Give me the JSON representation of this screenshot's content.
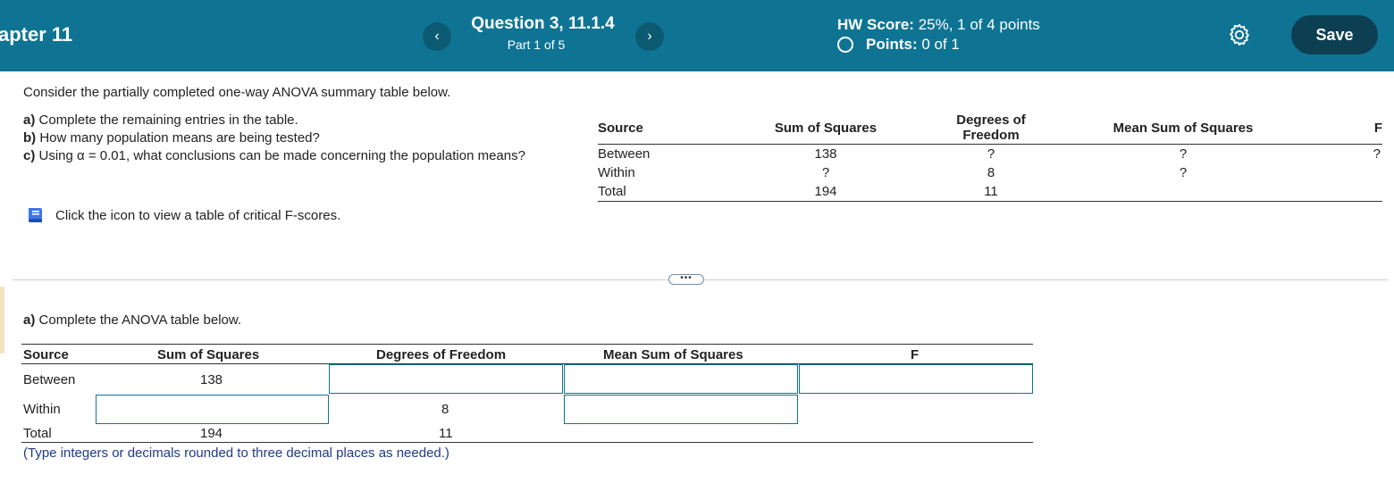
{
  "header": {
    "chapter": "apter 11",
    "question_title": "Question 3, 11.1.4",
    "question_part": "Part 1 of 5",
    "hw_score_label": "HW Score:",
    "hw_score_value": "25%, 1 of 4 points",
    "points_label": "Points:",
    "points_value": "0 of 1",
    "save_label": "Save",
    "prev_icon": "‹",
    "next_icon": "›",
    "accent_color": "#0f7494"
  },
  "question": {
    "intro": "Consider the partially completed one-way ANOVA summary table below.",
    "items": [
      {
        "letter": "a)",
        "text": "Complete the remaining entries in the table."
      },
      {
        "letter": "b)",
        "text": "How many population means are being tested?"
      },
      {
        "letter": "c)",
        "text": "Using α = 0.01, what conclusions can be made concerning the population means?"
      }
    ],
    "book_text": "Click the icon to view a table of critical F-scores."
  },
  "given_table": {
    "headers": [
      "Source",
      "Sum of Squares",
      "Degrees of Freedom",
      "Mean Sum of Squares",
      "F"
    ],
    "rows": [
      [
        "Between",
        "138",
        "?",
        "?",
        "?"
      ],
      [
        "Within",
        "?",
        "8",
        "?",
        ""
      ],
      [
        "Total",
        "194",
        "11",
        "",
        ""
      ]
    ]
  },
  "divider": {
    "more_label": "•••"
  },
  "part_a": {
    "letter": "a)",
    "text": "Complete the ANOVA table below.",
    "headers": [
      "Source",
      "Sum of Squares",
      "Degrees of Freedom",
      "Mean Sum of Squares",
      "F"
    ],
    "rows": {
      "between": {
        "source": "Between",
        "ss": "138"
      },
      "within": {
        "source": "Within",
        "df": "8"
      },
      "total": {
        "source": "Total",
        "ss": "194",
        "df": "11"
      }
    },
    "hint": "(Type integers or decimals rounded to three decimal places as needed.)"
  }
}
